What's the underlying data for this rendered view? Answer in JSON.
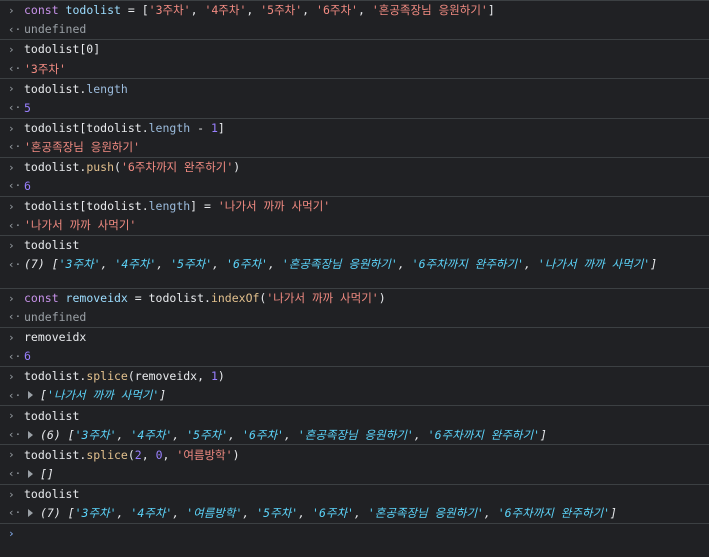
{
  "lines": [
    {
      "in": true,
      "parts": [
        [
          "kw",
          "const "
        ],
        [
          "kw2",
          "todolist"
        ],
        [
          "plain",
          " = ["
        ],
        [
          "str",
          "'3주차'"
        ],
        [
          "plain",
          ", "
        ],
        [
          "str",
          "'4주차'"
        ],
        [
          "plain",
          ", "
        ],
        [
          "str",
          "'5주차'"
        ],
        [
          "plain",
          ", "
        ],
        [
          "str",
          "'6주차'"
        ],
        [
          "plain",
          ", "
        ],
        [
          "str",
          "'혼공족장님 응원하기'"
        ],
        [
          "plain",
          "]"
        ]
      ]
    },
    {
      "out": true,
      "parts": [
        [
          "muted",
          "undefined"
        ]
      ]
    },
    {
      "in": true,
      "parts": [
        [
          "plain",
          "todolist[0]"
        ]
      ]
    },
    {
      "out": true,
      "parts": [
        [
          "str",
          "'3주차'"
        ]
      ]
    },
    {
      "in": true,
      "parts": [
        [
          "plain",
          "todolist."
        ],
        [
          "prop",
          "length"
        ]
      ]
    },
    {
      "out": true,
      "parts": [
        [
          "num",
          "5"
        ]
      ]
    },
    {
      "in": true,
      "parts": [
        [
          "plain",
          "todolist[todolist."
        ],
        [
          "prop",
          "length"
        ],
        [
          "plain",
          " - "
        ],
        [
          "num",
          "1"
        ],
        [
          "plain",
          "]"
        ]
      ]
    },
    {
      "out": true,
      "parts": [
        [
          "str",
          "'혼공족장님 응원하기'"
        ]
      ]
    },
    {
      "in": true,
      "parts": [
        [
          "plain",
          "todolist."
        ],
        [
          "fn",
          "push"
        ],
        [
          "plain",
          "("
        ],
        [
          "str",
          "'6주차까지 완주하기'"
        ],
        [
          "plain",
          ")"
        ]
      ]
    },
    {
      "out": true,
      "parts": [
        [
          "num",
          "6"
        ]
      ]
    },
    {
      "in": true,
      "parts": [
        [
          "plain",
          "todolist[todolist."
        ],
        [
          "prop",
          "length"
        ],
        [
          "plain",
          "] = "
        ],
        [
          "str",
          "'나가서 까까 사먹기'"
        ]
      ]
    },
    {
      "out": true,
      "parts": [
        [
          "str",
          "'나가서 까까 사먹기'"
        ]
      ]
    },
    {
      "in": true,
      "parts": [
        [
          "plain",
          "todolist"
        ]
      ]
    },
    {
      "out": true,
      "expand": true,
      "tall": true,
      "parts": [
        [
          "plain",
          "(7) ["
        ],
        [
          "strout",
          "'3주차'"
        ],
        [
          "plain",
          ", "
        ],
        [
          "strout",
          "'4주차'"
        ],
        [
          "plain",
          ", "
        ],
        [
          "strout",
          "'5주차'"
        ],
        [
          "plain",
          ", "
        ],
        [
          "strout",
          "'6주차'"
        ],
        [
          "plain",
          ", "
        ],
        [
          "strout",
          "'혼공족장님 응원하기'"
        ],
        [
          "plain",
          ", "
        ],
        [
          "strout",
          "'6주차까지 완주하기'"
        ],
        [
          "plain",
          ", "
        ],
        [
          "strout",
          "'나가서 까까 사먹기'"
        ],
        [
          "plain",
          "]"
        ]
      ]
    },
    {
      "in": true,
      "parts": [
        [
          "kw",
          "const "
        ],
        [
          "kw2",
          "removeidx"
        ],
        [
          "plain",
          " = todolist."
        ],
        [
          "fn",
          "indexOf"
        ],
        [
          "plain",
          "("
        ],
        [
          "str",
          "'나가서 까까 사먹기'"
        ],
        [
          "plain",
          ")"
        ]
      ]
    },
    {
      "out": true,
      "parts": [
        [
          "muted",
          "undefined"
        ]
      ]
    },
    {
      "in": true,
      "parts": [
        [
          "plain",
          "removeidx"
        ]
      ]
    },
    {
      "out": true,
      "parts": [
        [
          "num",
          "6"
        ]
      ]
    },
    {
      "in": true,
      "parts": [
        [
          "plain",
          "todolist."
        ],
        [
          "fn",
          "splice"
        ],
        [
          "plain",
          "(removeidx, "
        ],
        [
          "num",
          "1"
        ],
        [
          "plain",
          ")"
        ]
      ]
    },
    {
      "out": true,
      "expand": true,
      "parts": [
        [
          "plain",
          "["
        ],
        [
          "strout",
          "'나가서 까까 사먹기'"
        ],
        [
          "plain",
          "]"
        ]
      ]
    },
    {
      "in": true,
      "parts": [
        [
          "plain",
          "todolist"
        ]
      ]
    },
    {
      "out": true,
      "expand": true,
      "parts": [
        [
          "plain",
          "(6) ["
        ],
        [
          "strout",
          "'3주차'"
        ],
        [
          "plain",
          ", "
        ],
        [
          "strout",
          "'4주차'"
        ],
        [
          "plain",
          ", "
        ],
        [
          "strout",
          "'5주차'"
        ],
        [
          "plain",
          ", "
        ],
        [
          "strout",
          "'6주차'"
        ],
        [
          "plain",
          ", "
        ],
        [
          "strout",
          "'혼공족장님 응원하기'"
        ],
        [
          "plain",
          ", "
        ],
        [
          "strout",
          "'6주차까지 완주하기'"
        ],
        [
          "plain",
          "]"
        ]
      ]
    },
    {
      "in": true,
      "parts": [
        [
          "plain",
          "todolist."
        ],
        [
          "fn",
          "splice"
        ],
        [
          "plain",
          "("
        ],
        [
          "num",
          "2"
        ],
        [
          "plain",
          ", "
        ],
        [
          "num",
          "0"
        ],
        [
          "plain",
          ", "
        ],
        [
          "str",
          "'여름방학'"
        ],
        [
          "plain",
          ")"
        ]
      ]
    },
    {
      "out": true,
      "expand": true,
      "parts": [
        [
          "plain",
          "[]"
        ]
      ]
    },
    {
      "in": true,
      "parts": [
        [
          "plain",
          "todolist"
        ]
      ]
    },
    {
      "out": true,
      "expand": true,
      "parts": [
        [
          "plain",
          "(7) ["
        ],
        [
          "strout",
          "'3주차'"
        ],
        [
          "plain",
          ", "
        ],
        [
          "strout",
          "'4주차'"
        ],
        [
          "plain",
          ", "
        ],
        [
          "strout",
          "'여름방학'"
        ],
        [
          "plain",
          ", "
        ],
        [
          "strout",
          "'5주차'"
        ],
        [
          "plain",
          ", "
        ],
        [
          "strout",
          "'6주차'"
        ],
        [
          "plain",
          ", "
        ],
        [
          "strout",
          "'혼공족장님 응원하기'"
        ],
        [
          "plain",
          ", "
        ],
        [
          "strout",
          "'6주차까지 완주하기'"
        ],
        [
          "plain",
          "]"
        ]
      ]
    }
  ],
  "glyphs": {
    "input": "›",
    "output": "‹·",
    "prompt": "›"
  }
}
